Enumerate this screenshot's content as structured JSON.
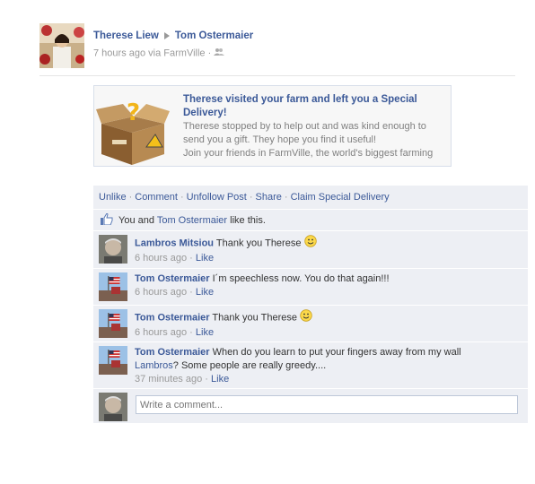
{
  "post": {
    "author": "Therese Liew",
    "target": "Tom Ostermaier",
    "time": "7 hours ago",
    "via_prefix": "via",
    "app": "FarmVille",
    "audience_icon": "friends-icon"
  },
  "attachment": {
    "title": "Therese visited your farm and left you a Special Delivery!",
    "description": "Therese stopped by to help out and was kind enough to send you a gift. They hope you find it useful!",
    "join_text": "Join your friends in FarmVille, the world's biggest farming",
    "image_icon": "mystery-gift-box-icon"
  },
  "actions": {
    "unlike": "Unlike",
    "comment": "Comment",
    "unfollow": "Unfollow Post",
    "share": "Share",
    "claim": "Claim Special Delivery"
  },
  "likes": {
    "prefix": "You and",
    "name": "Tom Ostermaier",
    "suffix": "like this."
  },
  "comments": [
    {
      "name": "Lambros Mitsiou",
      "text": "Thank you Therese",
      "smiley": true,
      "time": "6 hours ago",
      "like": "Like"
    },
    {
      "name": "Tom Ostermaier",
      "text": "I´m speechless now. You do that again!!!",
      "smiley": false,
      "time": "6 hours ago",
      "like": "Like"
    },
    {
      "name": "Tom Ostermaier",
      "text": "Thank you Therese",
      "smiley": true,
      "time": "6 hours ago",
      "like": "Like"
    },
    {
      "name": "Tom Ostermaier",
      "text": "When do you learn to put your fingers away from my wall",
      "mention": "Lambros",
      "text2": "? Some people are really greedy....",
      "time": "37 minutes ago",
      "like": "Like"
    }
  ],
  "composer": {
    "placeholder": "Write a comment..."
  }
}
